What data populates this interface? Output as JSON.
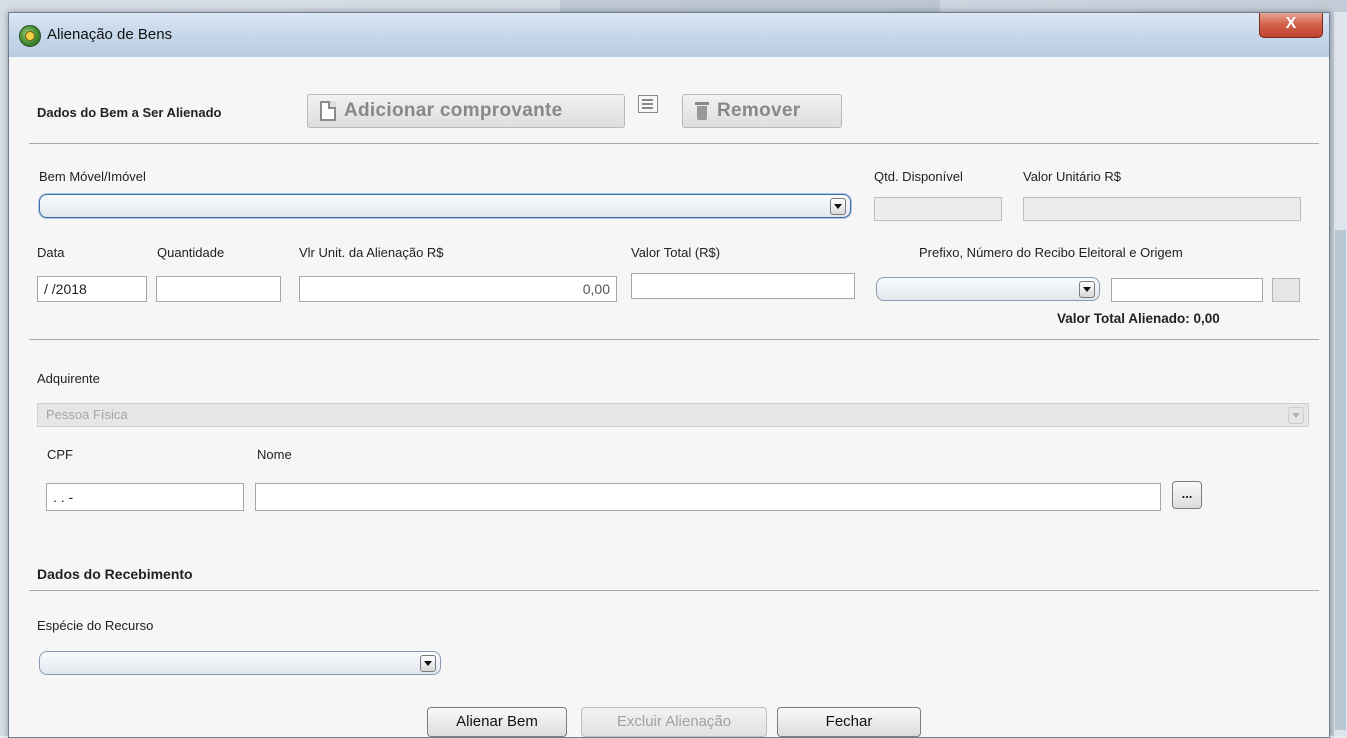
{
  "window": {
    "title": "Alienação de Bens",
    "close_label": "X"
  },
  "toolbar": {
    "section_title": "Dados do Bem a Ser Alienado",
    "add_receipt_label": "Adicionar comprovante",
    "remove_label": "Remover"
  },
  "bem": {
    "label": "Bem Móvel/Imóvel",
    "qtd_disponivel_label": "Qtd. Disponível",
    "valor_unitario_label": "Valor Unitário R$"
  },
  "alienacao": {
    "data_label": "Data",
    "data_value": "/ /2018",
    "quantidade_label": "Quantidade",
    "vlr_unit_label": "Vlr Unit. da Alienação R$",
    "vlr_unit_value": "0,00",
    "valor_total_label": "Valor Total (R$)",
    "prefixo_label": "Prefixo, Número do Recibo Eleitoral e Origem",
    "valor_total_alienado": "Valor Total Alienado: 0,00"
  },
  "adquirente": {
    "label": "Adquirente",
    "tipo_value": "Pessoa Física",
    "cpf_label": "CPF",
    "cpf_value": ". . -",
    "nome_label": "Nome",
    "search_label": "..."
  },
  "recebimento": {
    "section_title": "Dados do Recebimento",
    "especie_label": "Espécie do Recurso"
  },
  "footer": {
    "alienar_label": "Alienar Bem",
    "excluir_label": "Excluir Alienação",
    "fechar_label": "Fechar"
  }
}
